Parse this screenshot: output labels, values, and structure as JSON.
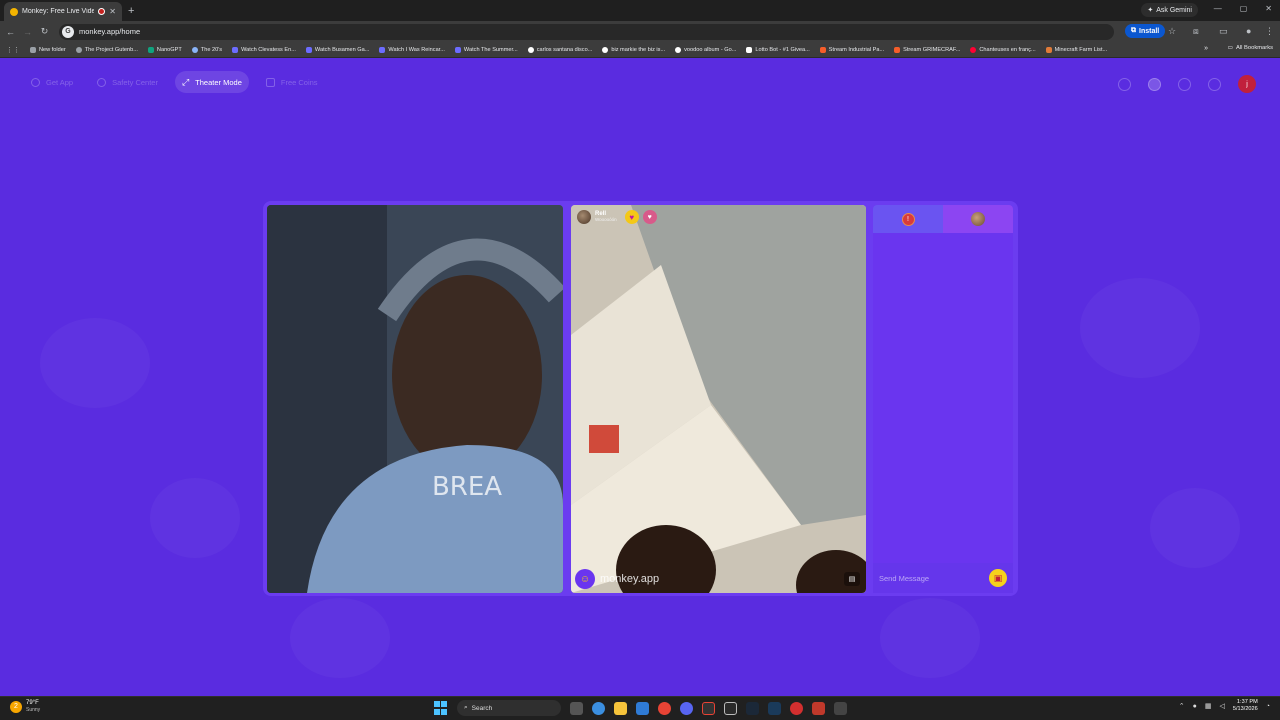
{
  "browser": {
    "tab": {
      "title": "Monkey: Free Live Video Ch",
      "close": "✕"
    },
    "new_tab": "+",
    "ask_gemini": "Ask Gemini",
    "window_controls": [
      "—",
      "▢",
      "✕"
    ],
    "url": "monkey.app/home",
    "install_label": "Install",
    "bookmarks": [
      {
        "label": "New folder",
        "icon": "folder-icon",
        "color": "#9aa0a6"
      },
      {
        "label": "The Project Gutenb...",
        "icon": "globe-icon",
        "color": "#9aa0a6"
      },
      {
        "label": "NanoGPT",
        "icon": "nanogpt-icon",
        "color": "#10a37f"
      },
      {
        "label": "The 20's",
        "icon": "globe-icon",
        "color": "#8ab4f8"
      },
      {
        "label": "Watch Clevatess En...",
        "icon": "site-icon",
        "color": "#6c6cff"
      },
      {
        "label": "Watch Busamen Ga...",
        "icon": "site-icon",
        "color": "#6c6cff"
      },
      {
        "label": "Watch I Was Reincar...",
        "icon": "site-icon",
        "color": "#6c6cff"
      },
      {
        "label": "Watch The Summer...",
        "icon": "site-icon",
        "color": "#6c6cff"
      },
      {
        "label": "carlos santana disco...",
        "icon": "google-icon",
        "color": "#ffffff"
      },
      {
        "label": "biz markie the biz is...",
        "icon": "google-icon",
        "color": "#ffffff"
      },
      {
        "label": "voodoo album - Go...",
        "icon": "google-icon",
        "color": "#ffffff"
      },
      {
        "label": "Lotto Bot - #1 Givea...",
        "icon": "grid-icon",
        "color": "#ffffff"
      },
      {
        "label": "Stream Industrial Pa...",
        "icon": "stream-icon",
        "color": "#f55d2a"
      },
      {
        "label": "Stream GRIMECRAF...",
        "icon": "stream-icon",
        "color": "#f55d2a"
      },
      {
        "label": "Chanteuses en franç...",
        "icon": "youtube-icon",
        "color": "#ff0033"
      },
      {
        "label": "Minecraft Farm List...",
        "icon": "minecraft-icon",
        "color": "#e07b39"
      }
    ],
    "more_bookmarks": "»",
    "all_bookmarks": "All Bookmarks"
  },
  "page": {
    "nav": [
      {
        "label": "Get App",
        "active": false
      },
      {
        "label": "Safety Center",
        "active": false
      },
      {
        "label": "Theater Mode",
        "active": true
      },
      {
        "label": "Free Coins",
        "active": false
      }
    ],
    "user_initial": "j",
    "remote_user": {
      "name": "Rell",
      "subtitle": "Wooooóón"
    },
    "watermark": "monkey.app",
    "chat": {
      "placeholder": "Send Message",
      "tab_badge": "!"
    }
  },
  "taskbar": {
    "weather": {
      "temp": "79°F",
      "condition": "Sunny",
      "badge": "2"
    },
    "search_label": "Search",
    "time": "1:37 PM",
    "date": "5/13/2026"
  },
  "colors": {
    "page_bg": "#5a2ce0",
    "stage_bg": "#6b3cf0",
    "accent_yellow": "#f4c816",
    "accent_red": "#c1203c"
  }
}
